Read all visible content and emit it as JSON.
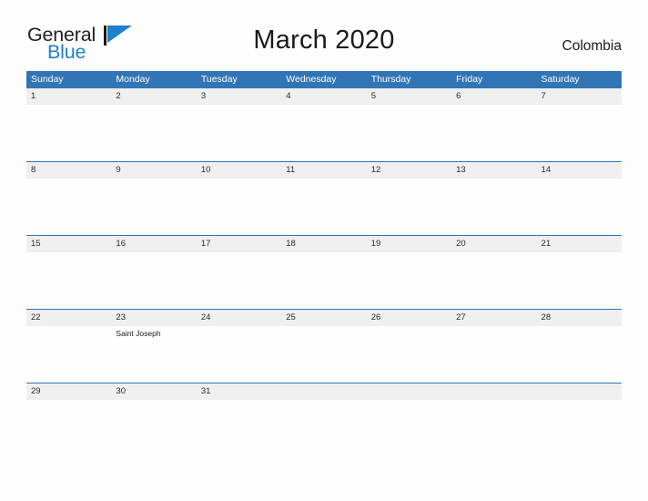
{
  "brand": {
    "name_top": "General",
    "name_bottom": "Blue",
    "flag_icon": "blue-triangle-flag-icon",
    "color_dark": "#231f20",
    "color_blue": "#1f7fd0"
  },
  "header": {
    "title": "March 2020",
    "country": "Colombia"
  },
  "colors": {
    "header_blue": "#3175b4",
    "daynum_band": "#efefef",
    "page_background": "#fdfdfd",
    "grid_line": "#3175b4"
  },
  "calendar": {
    "month": "March",
    "year": "2020",
    "weekdays": [
      "Sunday",
      "Monday",
      "Tuesday",
      "Wednesday",
      "Thursday",
      "Friday",
      "Saturday"
    ],
    "weeks": [
      {
        "days": [
          {
            "num": "1",
            "event": ""
          },
          {
            "num": "2",
            "event": ""
          },
          {
            "num": "3",
            "event": ""
          },
          {
            "num": "4",
            "event": ""
          },
          {
            "num": "5",
            "event": ""
          },
          {
            "num": "6",
            "event": ""
          },
          {
            "num": "7",
            "event": ""
          }
        ]
      },
      {
        "days": [
          {
            "num": "8",
            "event": ""
          },
          {
            "num": "9",
            "event": ""
          },
          {
            "num": "10",
            "event": ""
          },
          {
            "num": "11",
            "event": ""
          },
          {
            "num": "12",
            "event": ""
          },
          {
            "num": "13",
            "event": ""
          },
          {
            "num": "14",
            "event": ""
          }
        ]
      },
      {
        "days": [
          {
            "num": "15",
            "event": ""
          },
          {
            "num": "16",
            "event": ""
          },
          {
            "num": "17",
            "event": ""
          },
          {
            "num": "18",
            "event": ""
          },
          {
            "num": "19",
            "event": ""
          },
          {
            "num": "20",
            "event": ""
          },
          {
            "num": "21",
            "event": ""
          }
        ]
      },
      {
        "days": [
          {
            "num": "22",
            "event": ""
          },
          {
            "num": "23",
            "event": "Saint Joseph"
          },
          {
            "num": "24",
            "event": ""
          },
          {
            "num": "25",
            "event": ""
          },
          {
            "num": "26",
            "event": ""
          },
          {
            "num": "27",
            "event": ""
          },
          {
            "num": "28",
            "event": ""
          }
        ]
      },
      {
        "days": [
          {
            "num": "29",
            "event": ""
          },
          {
            "num": "30",
            "event": ""
          },
          {
            "num": "31",
            "event": ""
          },
          {
            "num": "",
            "event": ""
          },
          {
            "num": "",
            "event": ""
          },
          {
            "num": "",
            "event": ""
          },
          {
            "num": "",
            "event": ""
          }
        ]
      }
    ]
  }
}
